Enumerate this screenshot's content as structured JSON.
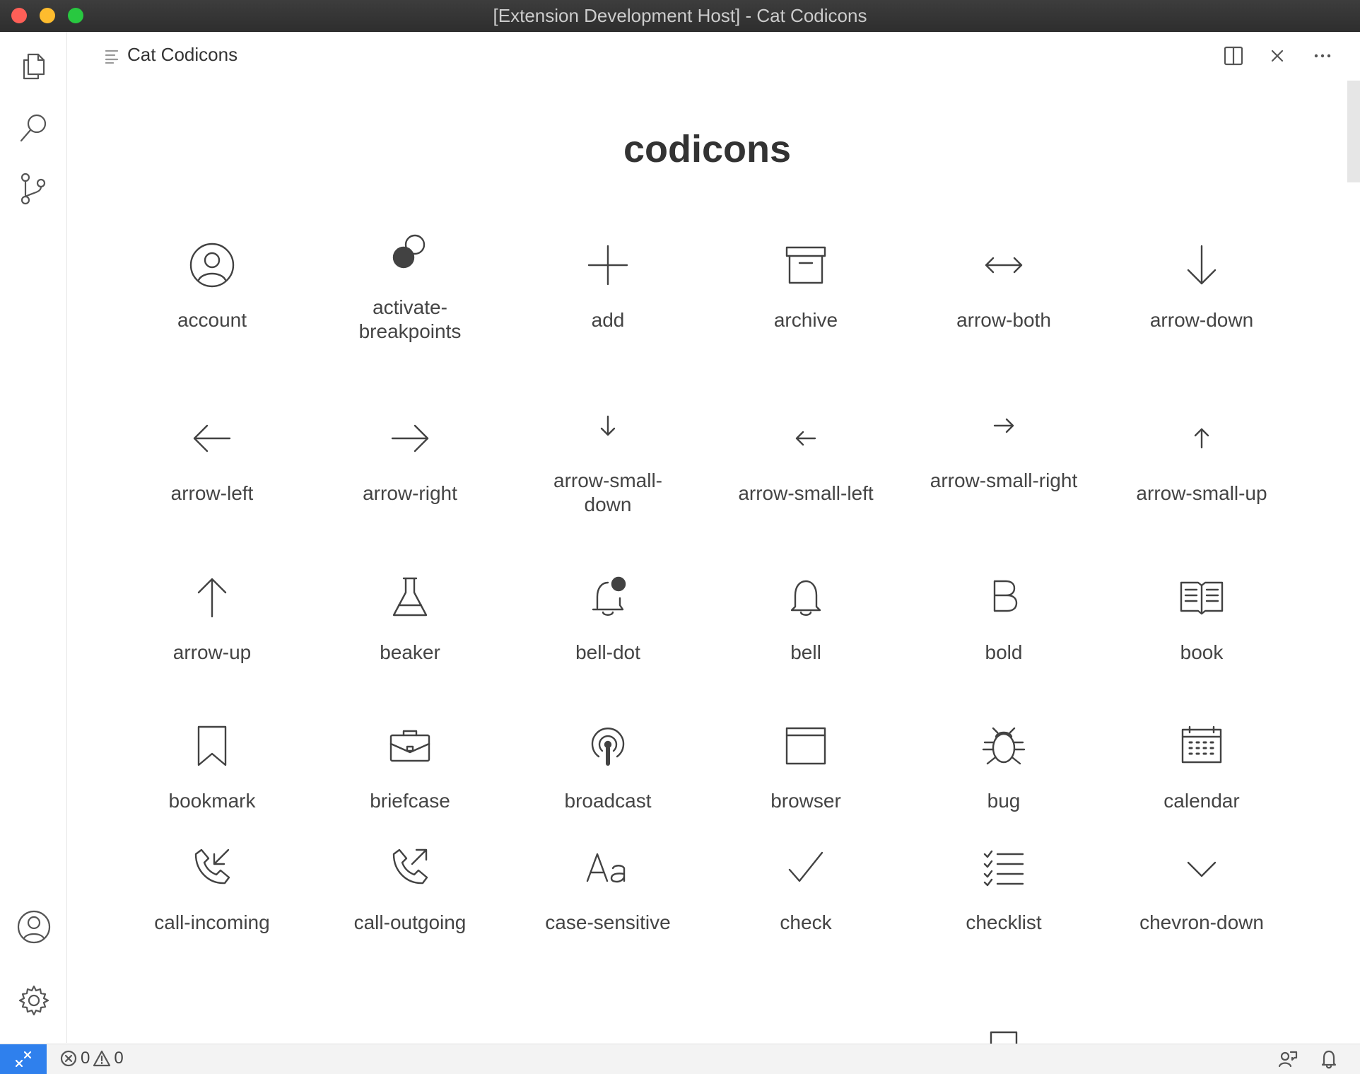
{
  "window": {
    "title": "[Extension Development Host] - Cat Codicons"
  },
  "tab": {
    "title": "Cat Codicons"
  },
  "page": {
    "title": "codicons"
  },
  "icons": [
    [
      "account",
      "activate-breakpoints",
      "add",
      "archive",
      "arrow-both",
      "arrow-down"
    ],
    [
      "arrow-left",
      "arrow-right",
      "arrow-small-down",
      "arrow-small-left",
      "arrow-small-right",
      "arrow-small-up"
    ],
    [
      "arrow-up",
      "beaker",
      "bell-dot",
      "bell",
      "bold",
      "book"
    ],
    [
      "bookmark",
      "briefcase",
      "broadcast",
      "browser",
      "bug",
      "calendar"
    ],
    [
      "call-incoming",
      "call-outgoing",
      "case-sensitive",
      "check",
      "checklist",
      "chevron-down"
    ]
  ],
  "status": {
    "errors": "0",
    "warnings": "0"
  },
  "colors": {
    "remote": "#2f80ed",
    "icon": "#424242"
  }
}
